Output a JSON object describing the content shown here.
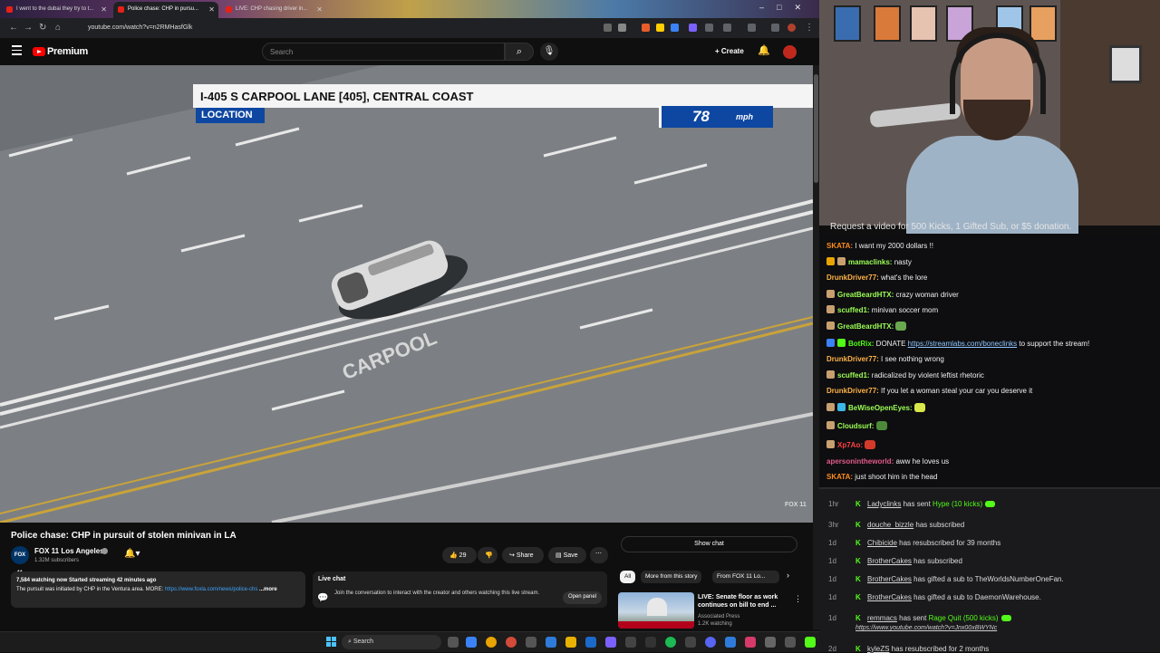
{
  "browser": {
    "tabs": [
      {
        "label": "I went to the dubai they try to t..."
      },
      {
        "label": "Police chase: CHP in pursu..."
      },
      {
        "label": "LIVE: CHP chasing driver in..."
      }
    ],
    "url": "youtube.com/watch?v=n2RMHasfGlk"
  },
  "youtube": {
    "logo_text": "Premium",
    "search_placeholder": "Search",
    "create_label": "+ Create"
  },
  "video": {
    "location_line": "I-405 S CARPOOL LANE [405], CENTRAL COAST",
    "location_label": "LOCATION",
    "speed_value": "78",
    "speed_unit": "mph",
    "watermark": "FOX 11",
    "title": "Police chase: CHP in pursuit of stolen minivan in LA",
    "channel_badge": "FOX 11",
    "channel": "FOX 11 Los Angeles",
    "subscribers": "1.32M subscribers",
    "likes": "29",
    "share_label": "Share",
    "save_label": "Save",
    "description_stats": "7,584 watching now  Started streaming 42 minutes ago",
    "description_text": "The pursuit was initiated by CHP in the Ventura area. MORE: ",
    "description_link": "https://www.foxla.com/news/police-chs",
    "description_more": "...more",
    "live_chat_title": "Live chat",
    "live_chat_text": "Join the conversation to interact with the creator and others watching this live stream.",
    "open_panel_label": "Open panel",
    "show_chat_label": "Show chat",
    "chips": [
      "All",
      "More from this story",
      "From FOX 11 Lo..."
    ],
    "related": {
      "title": "LIVE: Senate floor as work continues on bill to end ...",
      "channel": "Associated Press",
      "views": "1.2K watching"
    }
  },
  "taskbar": {
    "search_label": "Search"
  },
  "stream": {
    "request_text": "Request a video for 500 Kicks, 1 Gifted Sub, or $5 donation."
  },
  "chat": [
    {
      "user": "SKATA",
      "color": "#ff8c1a",
      "text": "I want my 2000 dollars !!",
      "badges": []
    },
    {
      "user": "mamaclinks",
      "color": "#9cff54",
      "text": "nasty",
      "badges": [
        "#e8a400",
        "#c8a070"
      ]
    },
    {
      "user": "DrunkDriver77",
      "color": "#ffb347",
      "text": "what's the lore",
      "badges": []
    },
    {
      "user": "GreatBeardHTX",
      "color": "#9cff54",
      "text": "crazy woman driver",
      "badges": [
        "#c8a070"
      ]
    },
    {
      "user": "scuffed1",
      "color": "#9cff54",
      "text": "minivan soccer mom",
      "badges": [
        "#c8a070"
      ]
    },
    {
      "user": "GreatBeardHTX",
      "color": "#9cff54",
      "text": "",
      "badges": [
        "#c8a070"
      ],
      "emote": "#6aa84f"
    },
    {
      "user": "BotRix",
      "color": "#53fc18",
      "text": "DONATE ",
      "link": "https://streamlabs.com/boneclinks",
      "after": " to support the stream!",
      "badges": [
        "#3b82f6",
        "#53fc18"
      ]
    },
    {
      "user": "DrunkDriver77",
      "color": "#ffb347",
      "text": "I see nothing wrong",
      "badges": []
    },
    {
      "user": "scuffed1",
      "color": "#9cff54",
      "text": "radicalized by violent leftist rhetoric",
      "badges": [
        "#c8a070"
      ]
    },
    {
      "user": "DrunkDriver77",
      "color": "#ffb347",
      "text": "If you let a woman steal your car you deserve it",
      "badges": []
    },
    {
      "user": "BeWiseOpenEyes",
      "color": "#9cff54",
      "text": "",
      "badges": [
        "#c8a070",
        "#3bb8e6"
      ],
      "emote": "#d8e84a"
    },
    {
      "user": "Cloudsurf",
      "color": "#9cff54",
      "text": "",
      "badges": [
        "#c8a070"
      ],
      "emote": "#4c8a3a"
    },
    {
      "user": "Xp7Ao",
      "color": "#ff4040",
      "text": "",
      "badges": [
        "#c8a070"
      ],
      "emote": "#d43a2a"
    },
    {
      "user": "apersonintheworld",
      "color": "#e05a8a",
      "text": "aww he loves us",
      "badges": []
    },
    {
      "user": "SKATA",
      "color": "#ff8c1a",
      "text": "just shoot him in the head",
      "badges": []
    }
  ],
  "events": [
    {
      "time": "1hr",
      "name": "Ladyclinks",
      "text": " has sent ",
      "highlight": "Hype (10 kicks)",
      "badge": true
    },
    {
      "time": "3hr",
      "name": "douche_bizzle",
      "text": " has subscribed",
      "highlight": "",
      "badge": false
    },
    {
      "time": "1d",
      "name": "Chibicide",
      "text": " has resubscribed for 39 months",
      "highlight": "",
      "badge": false
    },
    {
      "time": "1d",
      "name": "BrotherCakes",
      "text": " has subscribed",
      "highlight": "",
      "badge": false
    },
    {
      "time": "1d",
      "name": "BrotherCakes",
      "text": " has gifted a sub to ",
      "highlight": "",
      "tail": "TheWorldsNumberOneFan.",
      "badge": false
    },
    {
      "time": "1d",
      "name": "BrotherCakes",
      "text": " has gifted a sub to ",
      "highlight": "",
      "tail": "DaemonWarehouse.",
      "badge": false
    },
    {
      "time": "1d",
      "name": "remmacs",
      "text": " has sent ",
      "highlight": "Rage Quit (500 kicks)",
      "badge": true,
      "sub": "https://www.youtube.com/watch?v=Jnx00xBWYNc"
    },
    {
      "time": "2d",
      "name": "kyleZS",
      "text": " has resubscribed for 2 months",
      "highlight": "",
      "badge": false
    }
  ],
  "colors": {
    "youtube_red": "#ff0000",
    "kick_green": "#53fc18",
    "fox_blue": "#0e47a1"
  }
}
